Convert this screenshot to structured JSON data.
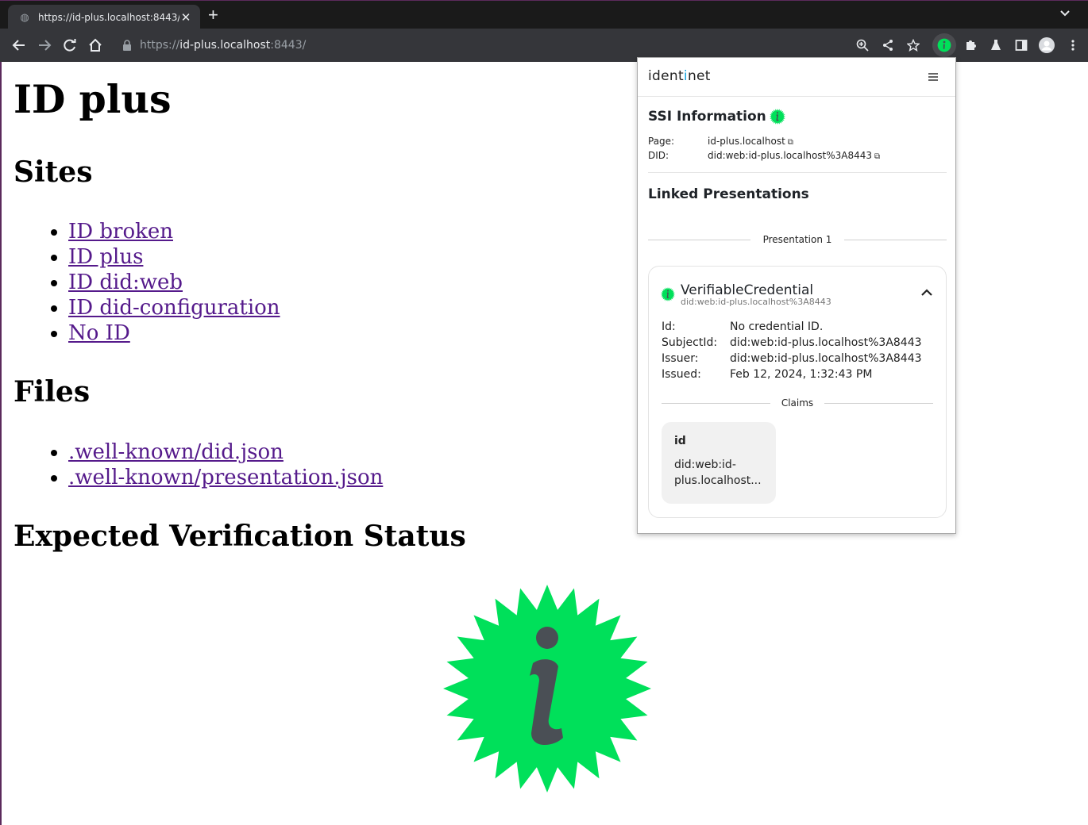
{
  "browser": {
    "tab_title": "https://id-plus.localhost:8443/",
    "url_scheme": "https://",
    "url_host": "id-plus.localhost",
    "url_rest": ":8443/",
    "colors": {
      "tabstrip": "#1a1a1a",
      "toolbar": "#35363a",
      "ext_badge": "#00e05a"
    }
  },
  "page": {
    "title": "ID plus",
    "sites_heading": "Sites",
    "sites": [
      "ID broken",
      "ID plus",
      "ID did:web",
      "ID did-configuration",
      "No ID"
    ],
    "files_heading": "Files",
    "files": [
      ".well-known/did.json",
      ".well-known/presentation.json"
    ],
    "status_heading": "Expected Verification Status",
    "status_icon": "green-info-badge-icon",
    "link_color": "#551a8b"
  },
  "popup": {
    "brand_pre": "ident",
    "brand_i": "i",
    "brand_post": "net",
    "ssi_title": "SSI Information",
    "page_label": "Page:",
    "page_value": "id-plus.localhost",
    "did_label": "DID:",
    "did_value": "did:web:id-plus.localhost%3A8443",
    "linked_title": "Linked Presentations",
    "presentation_label": "Presentation 1",
    "credential": {
      "type": "VerifiableCredential",
      "subtitle": "did:web:id-plus.localhost%3A8443",
      "id_label": "Id:",
      "id_value": "No credential ID.",
      "subject_label": "SubjectId:",
      "subject_value": "did:web:id-plus.localhost%3A8443",
      "issuer_label": "Issuer:",
      "issuer_value": "did:web:id-plus.localhost%3A8443",
      "issued_label": "Issued:",
      "issued_value": "Feb 12, 2024, 1:32:43 PM",
      "claims_label": "Claims",
      "claim_key": "id",
      "claim_value": "did:web:id-plus.localhost..."
    }
  }
}
